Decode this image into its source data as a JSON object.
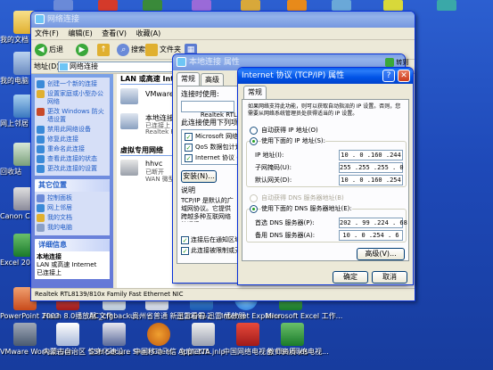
{
  "colors": {
    "desktop": "#1e49b8",
    "titlebar_active": "#0153e6",
    "titlebar_inactive": "#7597e0",
    "link_blue": "#215dc6",
    "window_face": "#ece9d8"
  },
  "desktop_icons": {
    "left": [
      {
        "label": "我的文档",
        "icon": "folder-icon"
      },
      {
        "label": "我的电脑",
        "icon": "computer-icon"
      },
      {
        "label": "网上邻居",
        "icon": "network-icon"
      },
      {
        "label": "回收站",
        "icon": "recycle-bin-icon"
      },
      {
        "label": "Canon CI Cannon",
        "icon": "printer-icon"
      },
      {
        "label": "Excel 20...",
        "icon": "excel-icon"
      }
    ],
    "bottom_row1": [
      {
        "label": "PowerPoint 2003",
        "icon": "powerpoint-icon"
      },
      {
        "label": "Flash 8.0播放器 文件",
        "icon": "flash-icon"
      },
      {
        "label": "AC_cfgbacku...",
        "icon": "file-icon"
      },
      {
        "label": "贵州省普通 新至200912",
        "icon": "file-icon"
      },
      {
        "label": "迅雷看看-迅雷 播放器",
        "icon": "player-icon"
      },
      {
        "label": "Internet Explorer",
        "icon": "ie-icon"
      },
      {
        "label": "Microsoft Excel 工作...",
        "icon": "excel-icon"
      }
    ],
    "bottom_row2": [
      {
        "label": "VMware Workstation",
        "icon": "vmware-icon"
      },
      {
        "label": "内蒙古自治区 信息化建设...",
        "icon": "document-icon"
      },
      {
        "label": "SSH Secure Shell Client",
        "icon": "ssh-icon"
      },
      {
        "label": "中国移动飞信 主窗口V5",
        "icon": "fetion-icon"
      },
      {
        "label": "AppletTA.jnlp",
        "icon": "java-icon"
      },
      {
        "label": "中国网络电视台 CBox网络电视...",
        "icon": "cbox-icon"
      },
      {
        "label": "教师资质.xls",
        "icon": "excel-icon"
      }
    ]
  },
  "net_window": {
    "title": "网络连接",
    "menu": [
      "文件(F)",
      "编辑(E)",
      "查看(V)",
      "收藏(A)"
    ],
    "toolbar": {
      "back": "后退",
      "search": "搜索",
      "folders": "文件夹"
    },
    "address_label": "地址(D)",
    "address_value": "网络连接",
    "lan_header": "LAN 或高速 Internet",
    "vpn_header": "虚拟专用网络",
    "connections": [
      {
        "name": "VMware Network Adapter",
        "status": "",
        "device": ""
      },
      {
        "name": "本地连接",
        "status": "已连接上",
        "device": "Realtek RTL8139"
      },
      {
        "name": "hhvc",
        "status": "已断开",
        "device": "WAN 微型端口"
      }
    ],
    "tasks_header": "网络任务",
    "tasks": [
      "创建一个新的连接",
      "设置家庭或小型办公网络",
      "更改 Windows 防火墙设置",
      "禁用此网络设备",
      "修复此连接",
      "重命名此连接",
      "查看此连接的状态",
      "更改此连接的设置"
    ],
    "other_header": "其它位置",
    "other_places": [
      "控制面板",
      "网上邻居",
      "我的文档",
      "我的电脑"
    ],
    "details_header": "详细信息",
    "details_name": "本地连接",
    "details_type": "LAN 或高速 Internet",
    "details_status": "已连接上",
    "statusbar": "Realtek RTL8139/810x Family Fast Ethernet NIC"
  },
  "props_window": {
    "title": "本地连接 属性",
    "tabs": [
      "常规",
      "高级"
    ],
    "connect_using": "连接时使用:",
    "adapter": "Realtek RTL8139/810x",
    "items_label": "此连接使用下列项目(O):",
    "items": [
      "Microsoft 网络客户端",
      "QoS 数据包计划程序",
      "Internet 协议 (TCP/IP)"
    ],
    "install_btn": "安装(N)...",
    "desc_label": "说明",
    "desc_text": "TCP/IP 是默认的广域网协议。它提供跨越多种互联网络的通讯。",
    "chk1": "连接后在通知区域显示图标(W)",
    "chk2": "此连接被限制或无连接时通知我(M)"
  },
  "tcpip_window": {
    "title": "Internet 协议 (TCP/IP) 属性",
    "tab": "常规",
    "intro": "如果网络支持此功能，则可以获取自动指派的 IP 设置。否则，您需要从网络系统管理员处获得适当的 IP 设置。",
    "auto_ip": "自动获得 IP 地址(O)",
    "manual_ip": "使用下面的 IP 地址(S):",
    "ip_label": "IP 地址(I):",
    "mask_label": "子网掩码(U):",
    "gateway_label": "默认网关(D):",
    "ip": "10 . 0 .160 .244",
    "mask": "255 .255 .255 . 0",
    "gateway": "10 . 0 .160 .254",
    "auto_dns": "自动获得 DNS 服务器地址(B)",
    "manual_dns": "使用下面的 DNS 服务器地址(E):",
    "dns1_label": "首选 DNS 服务器(P):",
    "dns2_label": "备用 DNS 服务器(A):",
    "dns1": "202 . 99 .224 . 68",
    "dns2": "10 . 0 .254 . 6",
    "advanced": "高级(V)...",
    "ok": "确定",
    "cancel": "取消",
    "goto": "转到"
  }
}
